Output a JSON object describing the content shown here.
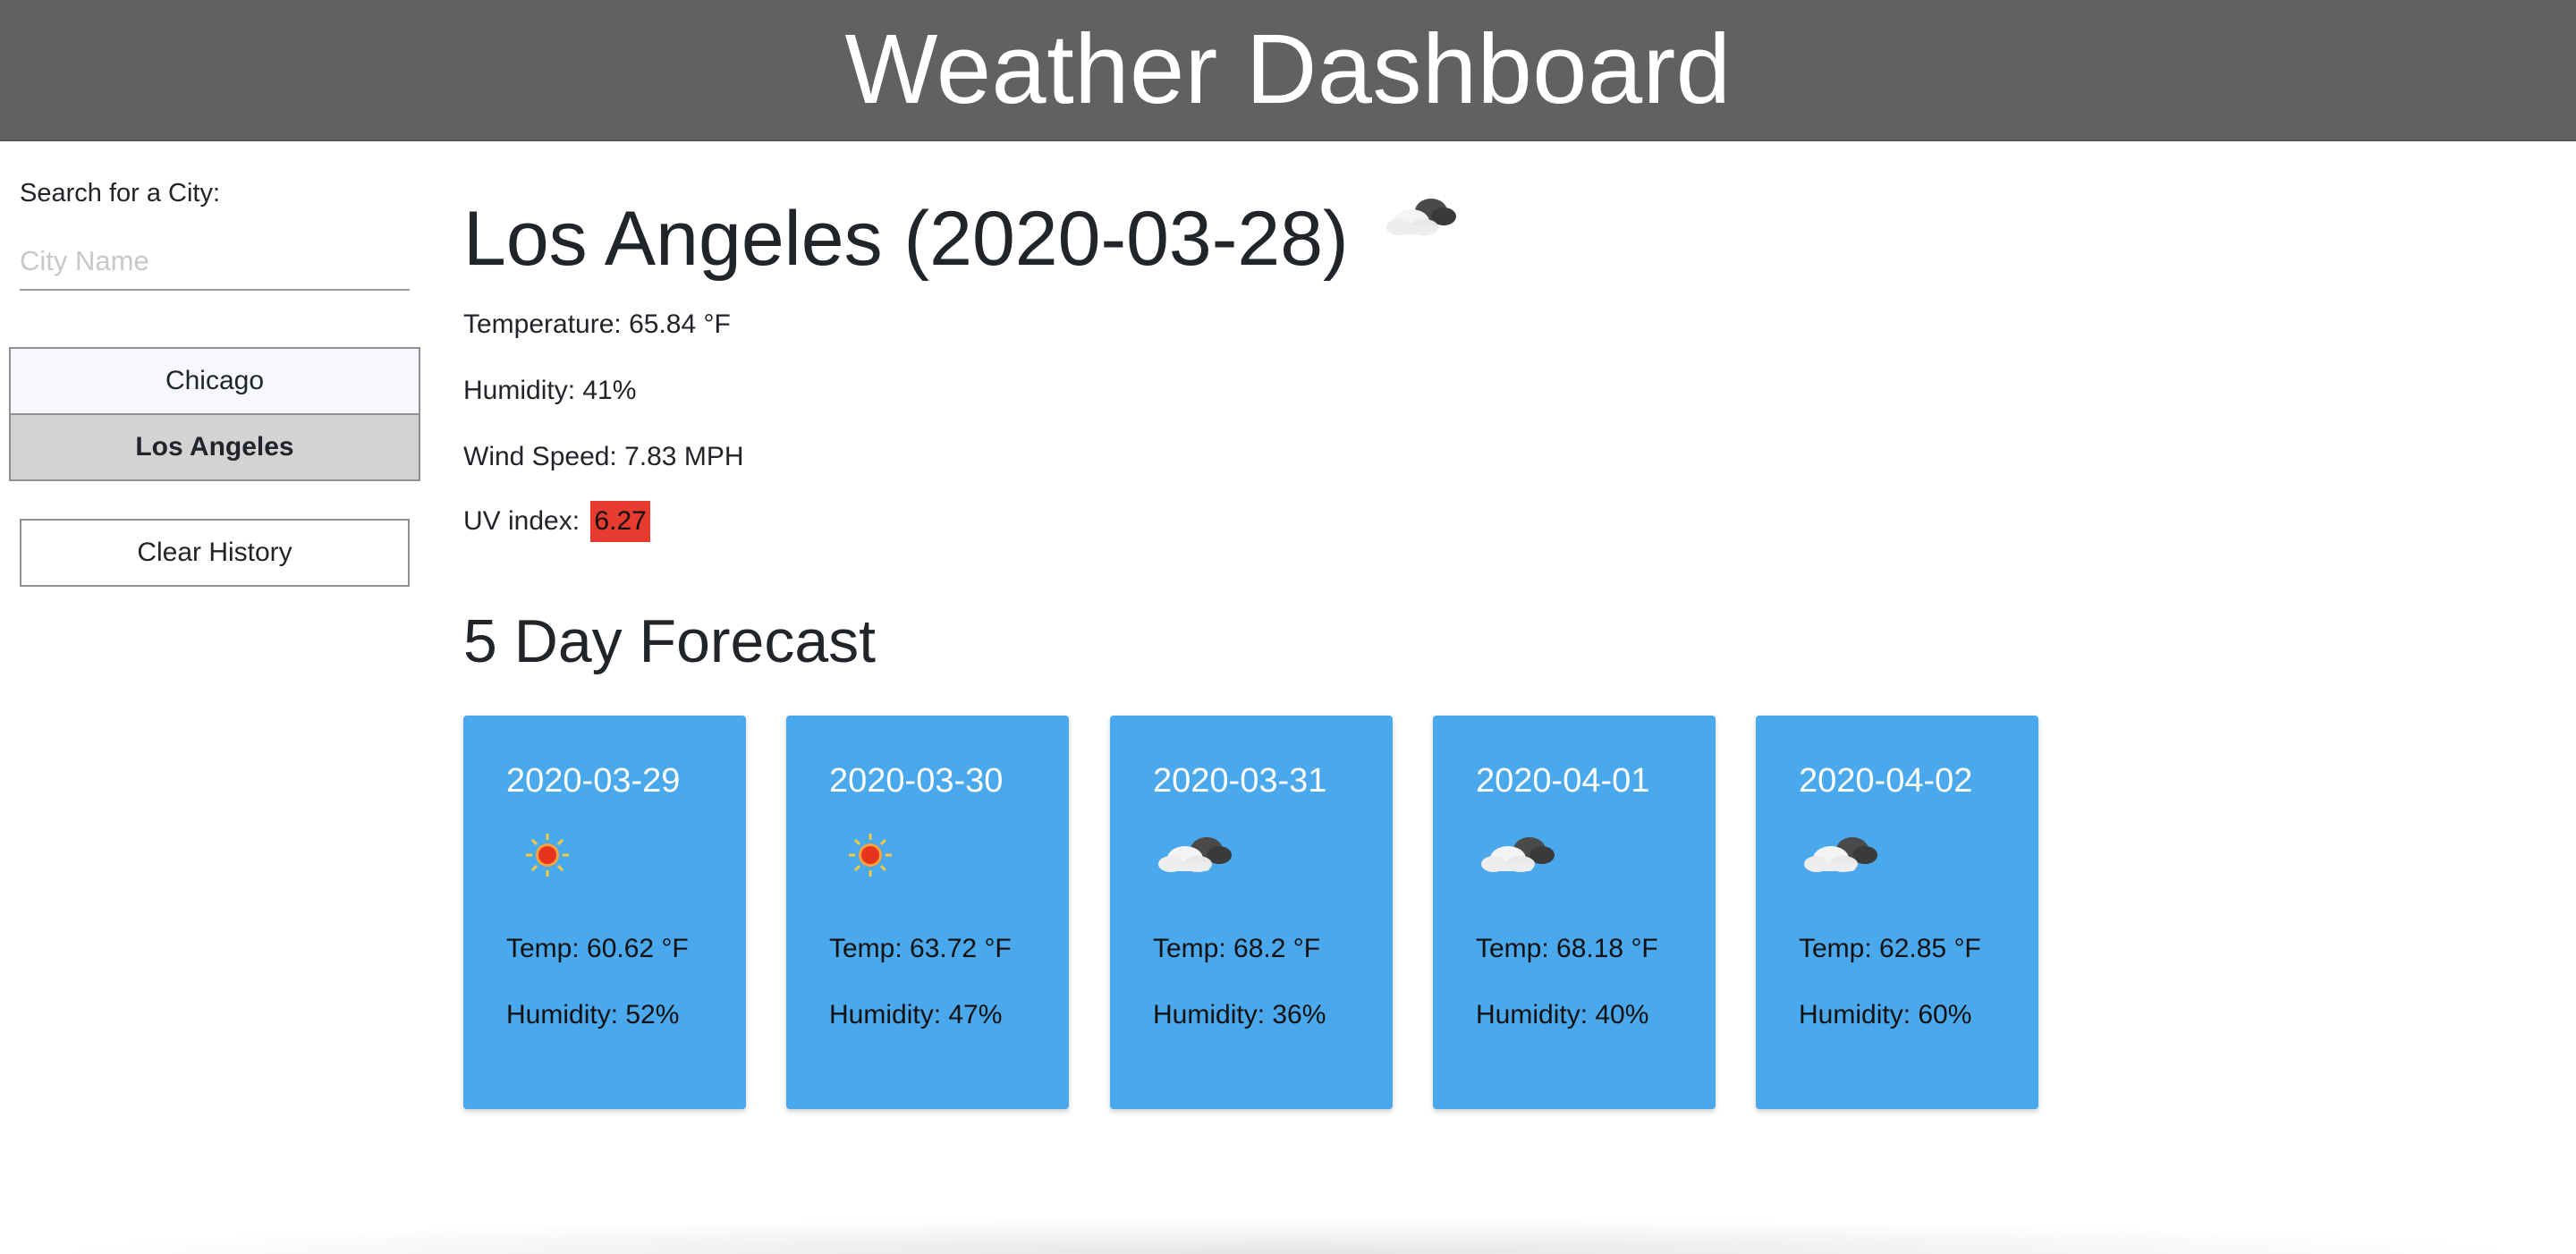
{
  "header": {
    "title": "Weather Dashboard"
  },
  "sidebar": {
    "search_label": "Search for a City:",
    "search_placeholder": "City Name",
    "search_value": "",
    "history": [
      {
        "label": "Chicago",
        "active": false
      },
      {
        "label": "Los Angeles",
        "active": true
      }
    ],
    "clear_label": "Clear History"
  },
  "current": {
    "title": "Los Angeles (2020-03-28)",
    "icon": "cloud-icon",
    "temperature": "Temperature: 65.84 °F",
    "humidity": "Humidity: 41%",
    "wind": "Wind Speed: 7.83 MPH",
    "uv_label": "UV index:",
    "uv_value": "6.27",
    "uv_color": "#e63b2e"
  },
  "forecast": {
    "heading": "5 Day Forecast",
    "card_color": "#4aa8ec",
    "days": [
      {
        "date": "2020-03-29",
        "icon": "sun-icon",
        "temp": "Temp: 60.62 °F",
        "humidity": "Humidity: 52%"
      },
      {
        "date": "2020-03-30",
        "icon": "sun-icon",
        "temp": "Temp: 63.72 °F",
        "humidity": "Humidity: 47%"
      },
      {
        "date": "2020-03-31",
        "icon": "cloud-icon",
        "temp": "Temp: 68.2 °F",
        "humidity": "Humidity: 36%"
      },
      {
        "date": "2020-04-01",
        "icon": "cloud-icon",
        "temp": "Temp: 68.18 °F",
        "humidity": "Humidity: 40%"
      },
      {
        "date": "2020-04-02",
        "icon": "cloud-icon",
        "temp": "Temp: 62.85 °F",
        "humidity": "Humidity: 60%"
      }
    ]
  },
  "colors": {
    "header_bg": "#616161",
    "history_active_bg": "#d3d3d3",
    "history_inactive_bg": "#f6f7ff"
  }
}
